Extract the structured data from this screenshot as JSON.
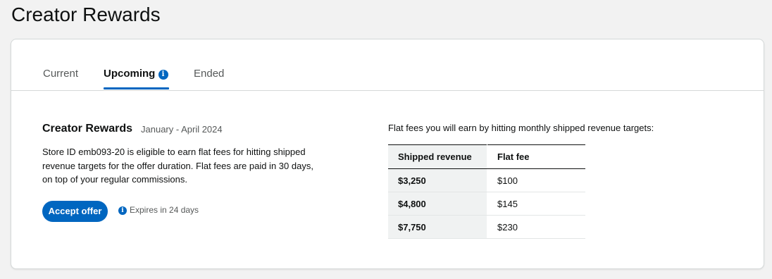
{
  "page": {
    "title": "Creator Rewards"
  },
  "tabs": [
    {
      "label": "Current",
      "active": false
    },
    {
      "label": "Upcoming",
      "active": true,
      "icon": "info-icon"
    },
    {
      "label": "Ended",
      "active": false
    }
  ],
  "offer": {
    "title": "Creator Rewards",
    "period": "January - April 2024",
    "description": "Store ID emb093-20 is eligible to earn flat fees for hitting shipped revenue targets for the offer duration. Flat fees are paid in 30 days, on top of your regular commissions.",
    "accept_label": "Accept offer",
    "expires_text": "Expires in 24 days"
  },
  "fees": {
    "caption": "Flat fees you will earn by hitting monthly shipped revenue targets:",
    "columns": [
      "Shipped revenue",
      "Flat fee"
    ],
    "rows": [
      [
        "$3,250",
        "$100"
      ],
      [
        "$4,800",
        "$145"
      ],
      [
        "$7,750",
        "$230"
      ]
    ]
  },
  "colors": {
    "accent": "#0066c0",
    "background": "#f2f2f2",
    "card": "#ffffff",
    "table_header_shade": "#f0f2f2"
  }
}
